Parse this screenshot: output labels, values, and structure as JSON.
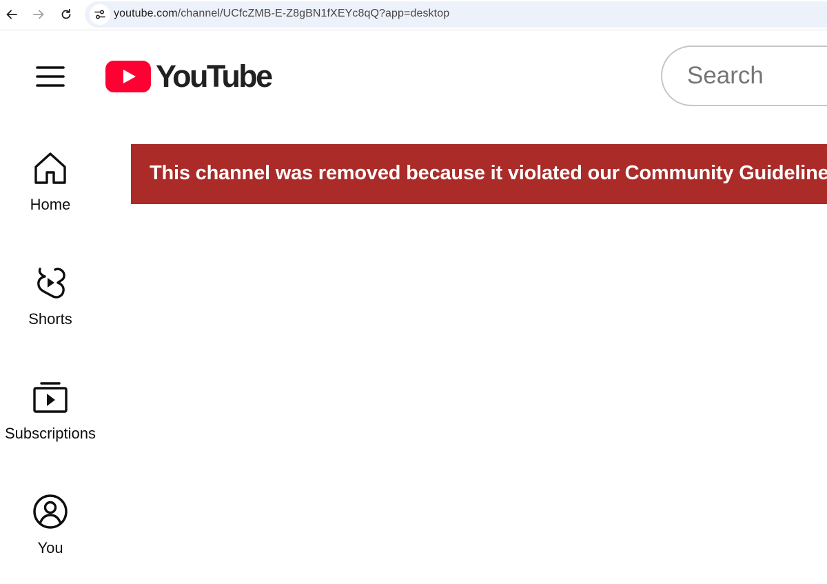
{
  "browser": {
    "url_host": "youtube.com",
    "url_path": "/channel/UCfcZMB-E-Z8gBN1fXEYc8qQ?app=desktop",
    "icons": [
      "back-arrow-icon",
      "forward-arrow-icon",
      "reload-icon",
      "site-settings-icon"
    ]
  },
  "masthead": {
    "logo_text": "YouTube",
    "brand_color": "#ff0033",
    "search_placeholder": "Search",
    "icons": [
      "hamburger-menu-icon",
      "youtube-play-logo-icon"
    ]
  },
  "sidebar": {
    "items": [
      {
        "label": "Home",
        "icon": "home-icon"
      },
      {
        "label": "Shorts",
        "icon": "shorts-icon"
      },
      {
        "label": "Subscriptions",
        "icon": "subscriptions-icon"
      },
      {
        "label": "You",
        "icon": "account-circle-icon"
      }
    ]
  },
  "banner": {
    "message": "This channel was removed because it violated our Community Guidelines.",
    "background_color": "#aa2b28",
    "text_color": "#ffffff"
  }
}
